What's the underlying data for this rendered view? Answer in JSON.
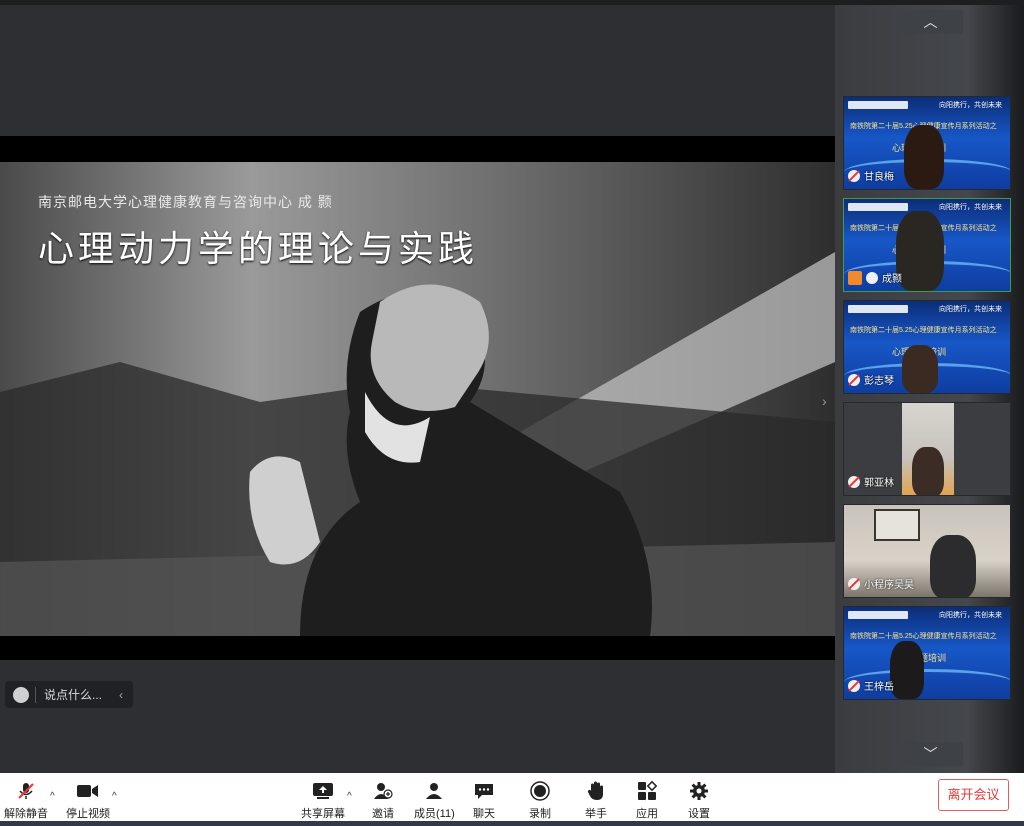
{
  "stage": {
    "slide": {
      "subtitle": "南京邮电大学心理健康教育与咨询中心  成  颢",
      "title": "心理动力学的理论与实践"
    },
    "chat": {
      "placeholder": "说点什么..."
    }
  },
  "participants": [
    {
      "name": "甘良梅",
      "muted": true,
      "bg": "blue"
    },
    {
      "name": "成颢",
      "muted": false,
      "host": true,
      "bg": "blue"
    },
    {
      "name": "彭志琴",
      "muted": true,
      "bg": "blue"
    },
    {
      "name": "郭亚林",
      "muted": true,
      "bg": "dark"
    },
    {
      "name": "小程序吴昊",
      "muted": true,
      "bg": "room"
    },
    {
      "name": "王梓岳",
      "muted": true,
      "bg": "blue"
    }
  ],
  "tile_banner": {
    "right_text": "向阳携行，共创未来",
    "line2": "南铁院第二十届5.25心理健康宣传月系列活动之",
    "line3": "心理专题培训"
  },
  "toolbar": {
    "unmute": "解除静音",
    "stop_video": "停止视频",
    "share": "共享屏幕",
    "invite": "邀请",
    "members": "成员(11)",
    "chat": "聊天",
    "record": "录制",
    "raise_hand": "举手",
    "apps": "应用",
    "settings": "设置",
    "leave": "离开会议"
  },
  "colors": {
    "leave": "#e23c3c",
    "host_badge": "#f08a2a",
    "tile_blue": "#1757c7"
  }
}
